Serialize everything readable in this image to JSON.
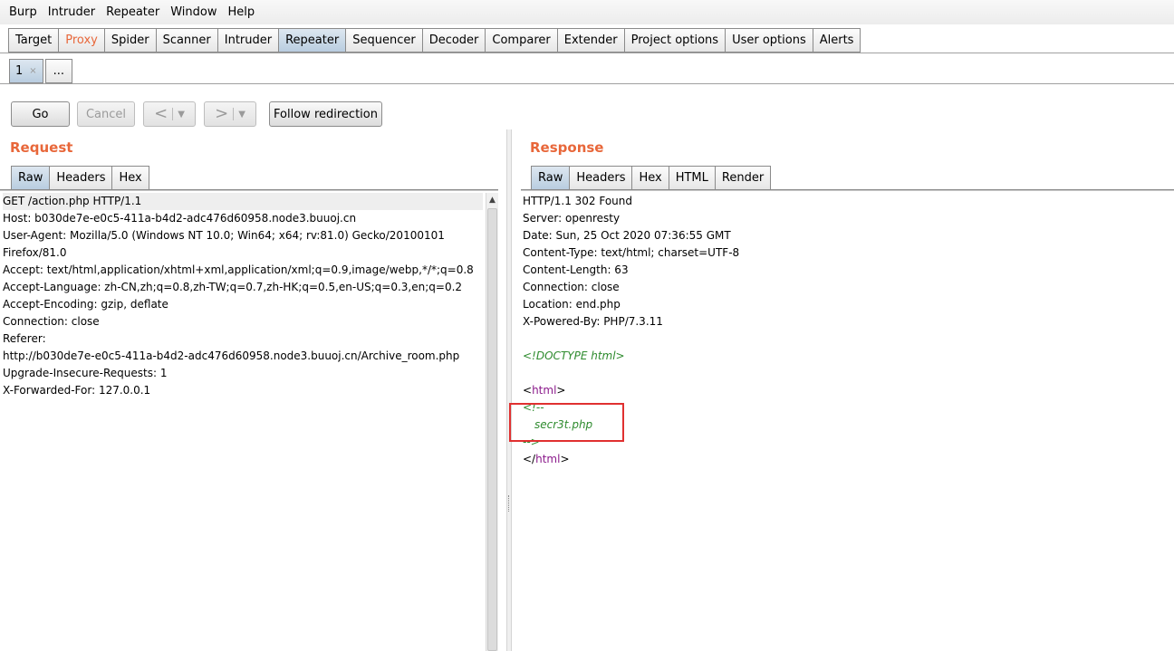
{
  "menubar": [
    "Burp",
    "Intruder",
    "Repeater",
    "Window",
    "Help"
  ],
  "main_tabs": [
    "Target",
    "Proxy",
    "Spider",
    "Scanner",
    "Intruder",
    "Repeater",
    "Sequencer",
    "Decoder",
    "Comparer",
    "Extender",
    "Project options",
    "User options",
    "Alerts"
  ],
  "active_main_tab": "Repeater",
  "repeater_tabs": {
    "tab1": "1",
    "close": "×",
    "more": "..."
  },
  "toolbar": {
    "go": "Go",
    "cancel": "Cancel",
    "back": "<",
    "forward": ">",
    "dropdown": "▼",
    "follow": "Follow redirection"
  },
  "request": {
    "title": "Request",
    "tabs": [
      "Raw",
      "Headers",
      "Hex"
    ],
    "lines": [
      "GET /action.php HTTP/1.1",
      "Host: b030de7e-e0c5-411a-b4d2-adc476d60958.node3.buuoj.cn",
      "User-Agent: Mozilla/5.0 (Windows NT 10.0; Win64; x64; rv:81.0) Gecko/20100101",
      "Firefox/81.0",
      "Accept: text/html,application/xhtml+xml,application/xml;q=0.9,image/webp,*/*;q=0.8",
      "Accept-Language: zh-CN,zh;q=0.8,zh-TW;q=0.7,zh-HK;q=0.5,en-US;q=0.3,en;q=0.2",
      "Accept-Encoding: gzip, deflate",
      "Connection: close",
      "Referer:",
      "http://b030de7e-e0c5-411a-b4d2-adc476d60958.node3.buuoj.cn/Archive_room.php",
      "Upgrade-Insecure-Requests: 1",
      "X-Forwarded-For: 127.0.0.1"
    ]
  },
  "response": {
    "title": "Response",
    "tabs": [
      "Raw",
      "Headers",
      "Hex",
      "HTML",
      "Render"
    ],
    "header_lines": [
      "HTTP/1.1 302 Found",
      "Server: openresty",
      "Date: Sun, 25 Oct 2020 07:36:55 GMT",
      "Content-Type: text/html; charset=UTF-8",
      "Content-Length: 63",
      "Connection: close",
      "Location: end.php",
      "X-Powered-By: PHP/7.3.11"
    ],
    "body": {
      "doctype": "<!DOCTYPE html>",
      "html_lt": "<",
      "html_tag": "html",
      "html_gt": ">",
      "comment_open": "<!--",
      "comment_text": "secr3t.php",
      "comment_close": "-->",
      "close_lt": "</",
      "close_tag": "html",
      "close_gt": ">"
    }
  },
  "colors": {
    "accent": "#e8673a",
    "active_tab": "#b9cde0",
    "highlight_box": "#e03030",
    "comment": "#2e8b2e",
    "tag": "#8b1a8b"
  }
}
